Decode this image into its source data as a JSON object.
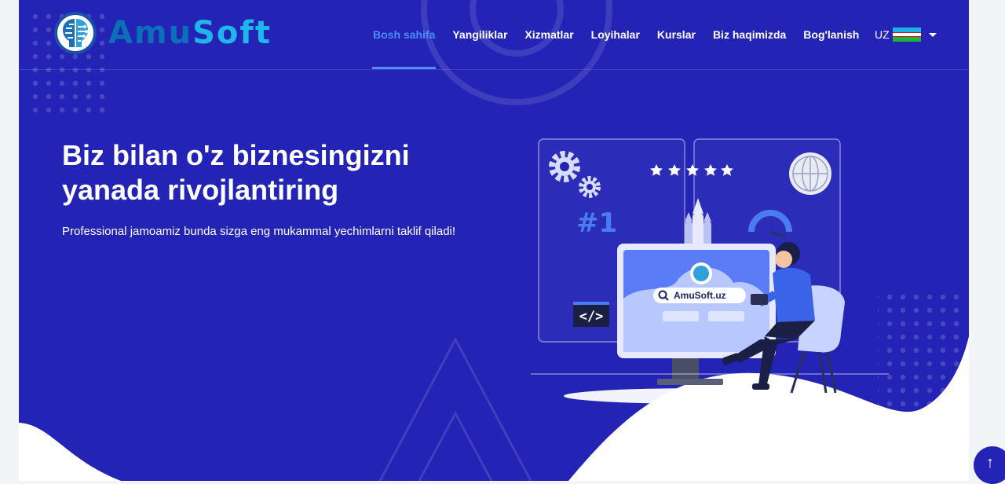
{
  "brand": {
    "part1": "Amu",
    "part2": "Soft"
  },
  "nav": {
    "items": [
      {
        "label": "Bosh sahifa",
        "active": true
      },
      {
        "label": "Yangiliklar"
      },
      {
        "label": "Xizmatlar"
      },
      {
        "label": "Loyihalar"
      },
      {
        "label": "Kurslar"
      },
      {
        "label": "Biz haqimizda"
      },
      {
        "label": "Bog'lanish"
      }
    ]
  },
  "language": {
    "code": "UZ"
  },
  "hero": {
    "headline": "Biz bilan o'z biznesingizni yanada rivojlantiring",
    "subtitle": "Professional jamoamiz bunda sizga eng mukammal yechimlarni taklif qiladi!"
  },
  "illustration": {
    "rank": "#1",
    "search_text": "AmuSoft.uz",
    "code_tag": "</>"
  },
  "colors": {
    "background": "#2324b5",
    "accent": "#4f8cff",
    "brand_dark": "#0d6fb8",
    "brand_light": "#1fb6ea"
  },
  "icons": [
    "brain-logo-icon",
    "gear-icon",
    "star-icon",
    "globe-icon",
    "rocket-icon",
    "search-icon",
    "code-icon",
    "uzbekistan-flag-icon",
    "chevron-down-icon",
    "arrow-up-icon"
  ]
}
